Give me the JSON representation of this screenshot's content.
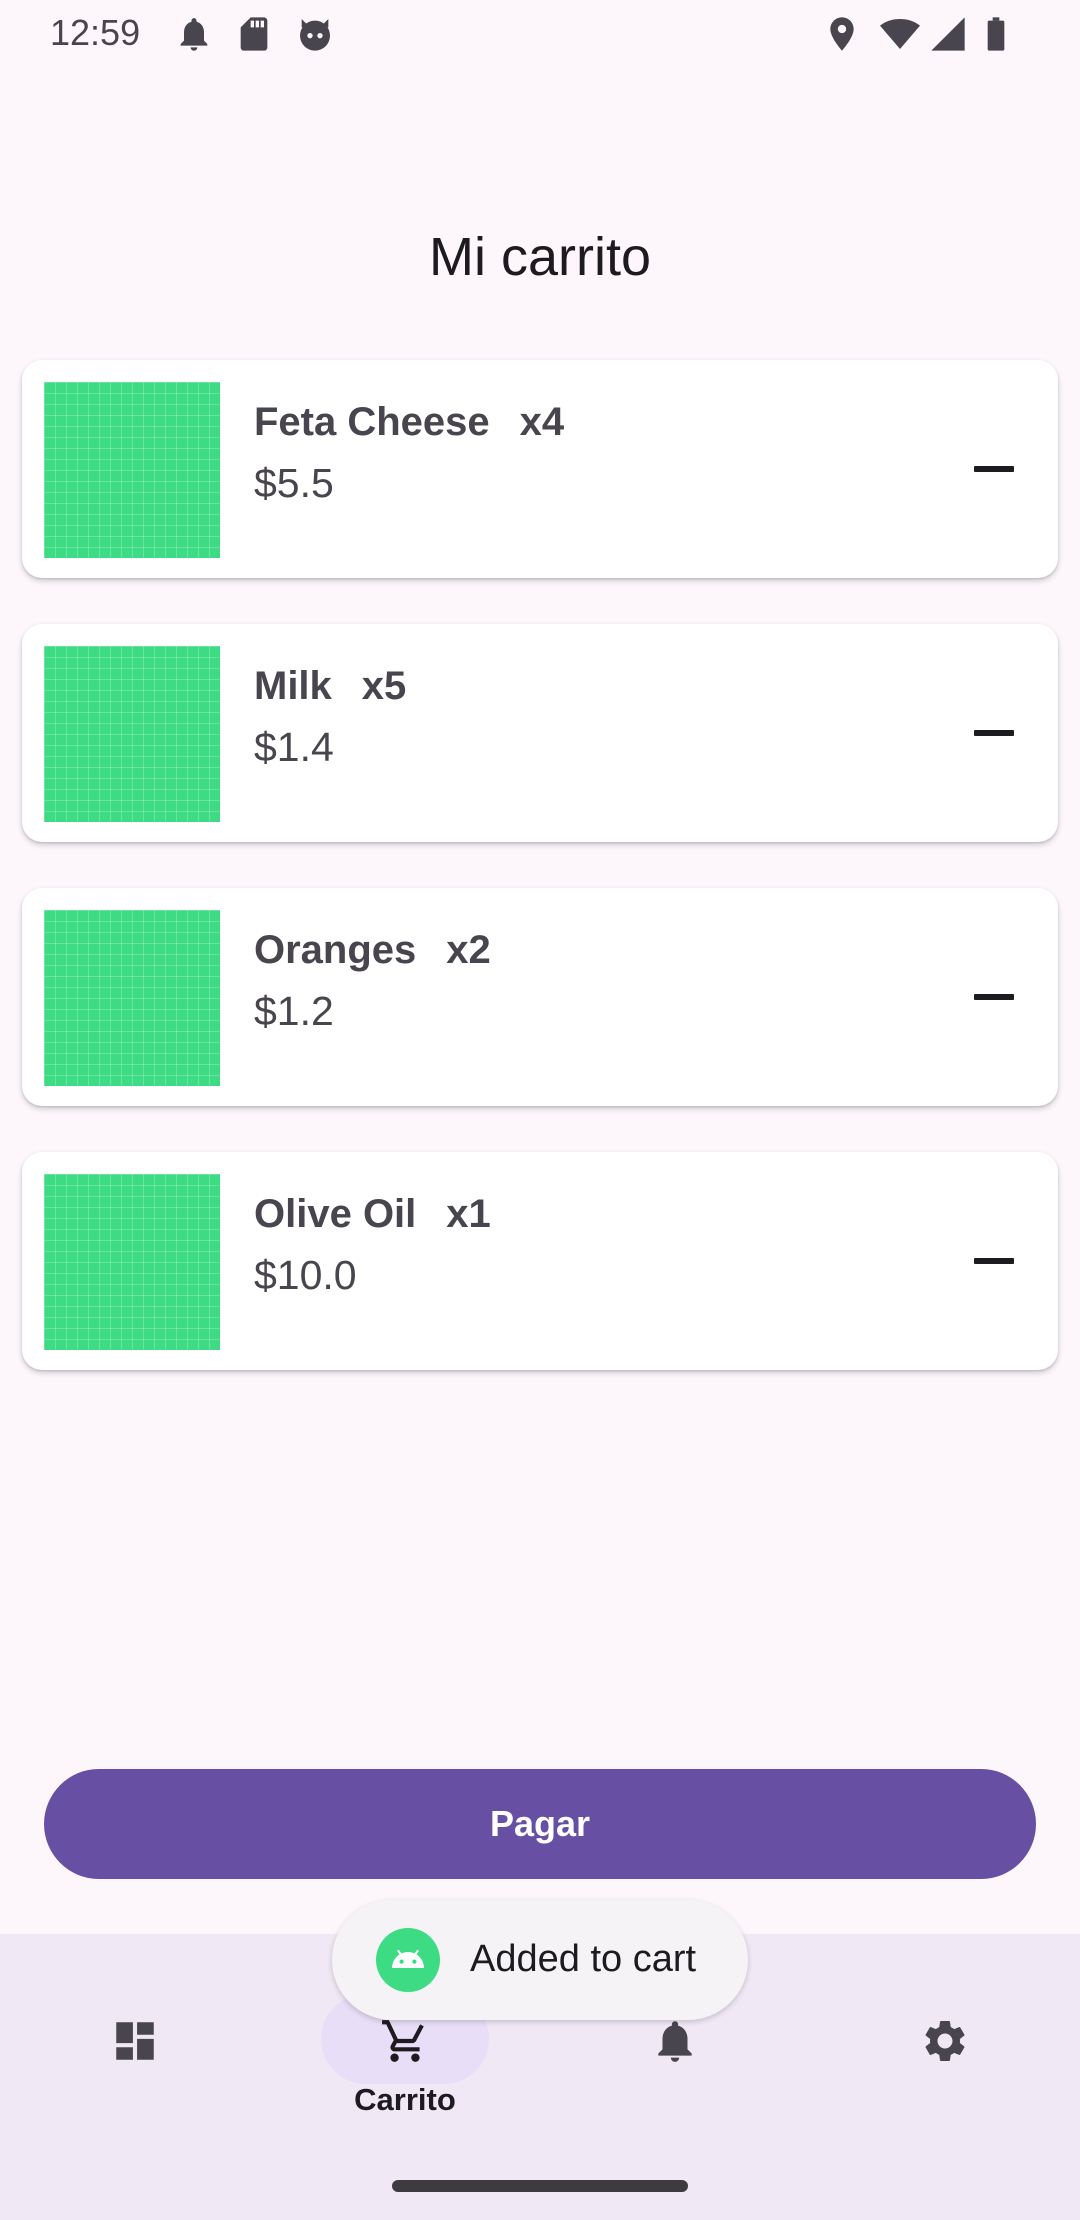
{
  "status_bar": {
    "time": "12:59",
    "left_icons": [
      "bell-icon",
      "sd-card-icon",
      "cat-face-icon"
    ],
    "right_icons": [
      "location-icon",
      "wifi-icon",
      "signal-icon",
      "battery-icon"
    ]
  },
  "title": "Mi carrito",
  "cart": {
    "items": [
      {
        "name": "Feta Cheese",
        "qty": "x4",
        "price": "$5.5"
      },
      {
        "name": "Milk",
        "qty": "x5",
        "price": "$1.4"
      },
      {
        "name": "Oranges",
        "qty": "x2",
        "price": "$1.2"
      },
      {
        "name": "Olive Oil",
        "qty": "x1",
        "price": "$10.0"
      }
    ],
    "remove_icon": "minus-icon",
    "thumbnail_color": "#3ddc84"
  },
  "pay_button": {
    "label": "Pagar",
    "color": "#674fa3"
  },
  "bottom_nav": {
    "items": [
      {
        "icon": "dashboard-icon",
        "label": ""
      },
      {
        "icon": "cart-icon",
        "label": "Carrito",
        "selected": true
      },
      {
        "icon": "bell-icon",
        "label": ""
      },
      {
        "icon": "gear-icon",
        "label": ""
      }
    ]
  },
  "toast": {
    "icon": "android-icon",
    "text": "Added to cart"
  }
}
